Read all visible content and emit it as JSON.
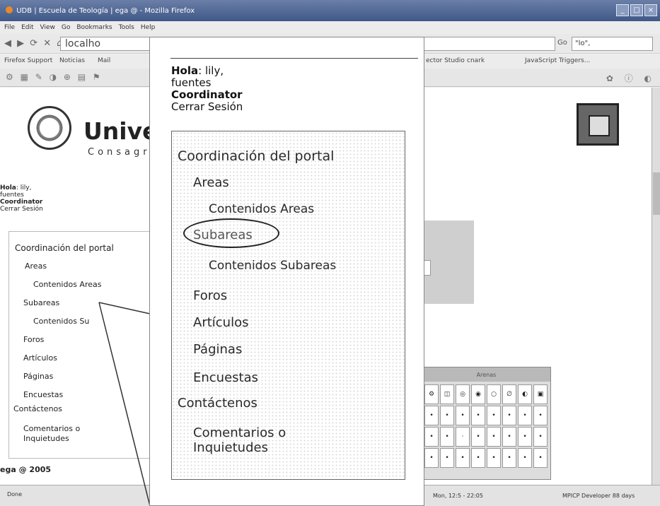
{
  "window": {
    "title": "UDB | Escuela de Teología | ega @ - Mozilla Firefox",
    "controls": [
      "_",
      "□",
      "×"
    ]
  },
  "menubar": [
    "File",
    "Edit",
    "View",
    "Go",
    "Bookmarks",
    "Tools",
    "Help"
  ],
  "navbar": {
    "nav_glyphs": "◀ ▶ ⟳ ✕ ⌂",
    "url": "localho",
    "go": "Go",
    "search": "\"lo\","
  },
  "bookmarks": {
    "left": [
      "Firefox Support",
      "Noticias",
      "Mail"
    ],
    "right": [
      "ector Studio",
      "cnark",
      "JavaScript Triggers..."
    ]
  },
  "devbar": {
    "glyphs": "⚙ ▦ ✎ ◑ ⊕ ▤ ⚑",
    "right_glyphs": "✿ ⓘ ◐"
  },
  "page": {
    "site_title": "Univer",
    "site_subtitle": "Consagr",
    "user": {
      "greeting_label": "Hola",
      "greeting_value": ": lily,",
      "surname": "fuentes",
      "role": "Coordinator",
      "logout": "Cerrar Sesión"
    },
    "menu": {
      "title": "Coordinación del portal",
      "items": [
        {
          "label": "Areas",
          "level": 1
        },
        {
          "label": "Contenidos Areas",
          "level": 2
        },
        {
          "label": "Subareas",
          "level": 1
        },
        {
          "label": "Contenidos Su",
          "level": 2
        },
        {
          "label": "Foros",
          "level": 1
        },
        {
          "label": "Artículos",
          "level": 1
        },
        {
          "label": "Páginas",
          "level": 1
        },
        {
          "label": "Encuestas",
          "level": 1
        },
        {
          "label": "Contáctenos",
          "level": 0
        },
        {
          "label": "Comentarios o",
          "level": 1
        },
        {
          "label": "Inquietudes",
          "level": 1
        }
      ]
    },
    "footer": "ega @ 2005",
    "tool_window_title": "Arenas"
  },
  "callout": {
    "greeting_label": "Hola",
    "greeting_value": ": lily,",
    "surname": "fuentes",
    "role": "Coordinator",
    "logout": "Cerrar Sesión",
    "menu_title": "Coordinación del portal",
    "menu_items": [
      "Areas",
      "Contenidos Areas",
      "Subareas",
      "Contenidos Subareas",
      "Foros",
      "Artículos",
      "Páginas",
      "Encuestas",
      "Contáctenos",
      "Comentarios o",
      "Inquietudes"
    ],
    "highlighted_item": "Subareas"
  },
  "statusbar": {
    "done": "Done",
    "clock": "Mon, 12:5 - 22:05",
    "devinfo": "MPICP Developer 88 days"
  }
}
